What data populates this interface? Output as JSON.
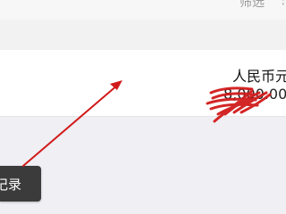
{
  "header": {
    "filter_label": "筛选",
    "overflow_icon": "more-dots-icon"
  },
  "record": {
    "currency_label": "人民币元",
    "amount_text": "8,000.00"
  },
  "floating": {
    "records_label": "记录"
  },
  "colors": {
    "annotation": "#d11a1a",
    "background": "#efeff4",
    "card": "#ffffff",
    "button_bg": "#3b3b3b"
  }
}
